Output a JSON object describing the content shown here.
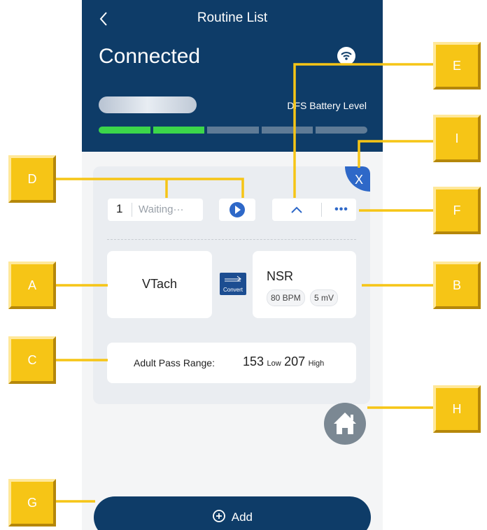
{
  "header": {
    "title": "Routine List",
    "status": "Connected",
    "battery_label": "DFS Battery Level",
    "battery": {
      "filled_segments": 2,
      "total_segments": 5
    }
  },
  "routine": {
    "remove_label": "X",
    "step_number": "1",
    "step_state": "Waiting···",
    "more_label": "•••",
    "from_rhythm": "VTach",
    "convert_label": "Convert",
    "to_rhythm": "NSR",
    "to_rate": "80 BPM",
    "to_amplitude": "5 mV",
    "pass_label": "Adult Pass Range:",
    "pass_low": "153",
    "pass_low_unit": "Low",
    "pass_high": "207",
    "pass_high_unit": "High"
  },
  "add_button": {
    "label": "Add"
  },
  "callouts": [
    "A",
    "B",
    "C",
    "D",
    "E",
    "F",
    "G",
    "H",
    "I"
  ],
  "icons": [
    "back-icon",
    "wifi-icon",
    "play-icon",
    "chevron-up-icon",
    "convert-icon",
    "home-icon",
    "add-circle-icon"
  ],
  "colors": {
    "header": "#0e3c68",
    "accent": "#2e68c8",
    "battery_on": "#3cd64a",
    "battery_off": "#5f7b96",
    "callout": "#f6c516"
  }
}
